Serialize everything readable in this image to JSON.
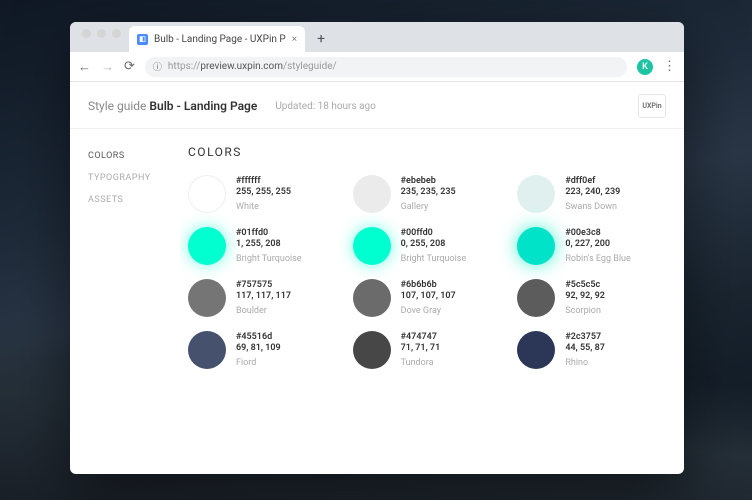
{
  "browser": {
    "tab_title": "Bulb - Landing Page - UXPin P",
    "url_host": "preview.uxpin.com",
    "url_path": "/styleguide/",
    "url_protocol": "https://",
    "avatar_letter": "K",
    "logo_text": "UXPin"
  },
  "header": {
    "prefix": "Style guide ",
    "title": "Bulb - Landing Page",
    "updated": "Updated: 18 hours ago"
  },
  "sidebar": {
    "items": [
      {
        "label": "COLORS",
        "active": true
      },
      {
        "label": "TYPOGRAPHY",
        "active": false
      },
      {
        "label": "ASSETS",
        "active": false
      }
    ]
  },
  "section": {
    "title": "COLORS"
  },
  "swatches": [
    {
      "hex": "#ffffff",
      "rgb": "255, 255, 255",
      "name": "White",
      "color": "#ffffff",
      "cls": "bordered"
    },
    {
      "hex": "#ebebeb",
      "rgb": "235, 235, 235",
      "name": "Gallery",
      "color": "#ebebeb",
      "cls": ""
    },
    {
      "hex": "#dff0ef",
      "rgb": "223, 240, 239",
      "name": "Swans Down",
      "color": "#dff0ef",
      "cls": ""
    },
    {
      "hex": "#01ffd0",
      "rgb": "1, 255, 208",
      "name": "Bright Turquoise",
      "color": "#01ffd0",
      "cls": "glow1"
    },
    {
      "hex": "#00ffd0",
      "rgb": "0, 255, 208",
      "name": "Bright Turquoise",
      "color": "#00ffd0",
      "cls": "glow1"
    },
    {
      "hex": "#00e3c8",
      "rgb": "0, 227, 200",
      "name": "Robin's Egg Blue",
      "color": "#00e3c8",
      "cls": "glow2"
    },
    {
      "hex": "#757575",
      "rgb": "117, 117, 117",
      "name": "Boulder",
      "color": "#757575",
      "cls": ""
    },
    {
      "hex": "#6b6b6b",
      "rgb": "107, 107, 107",
      "name": "Dove Gray",
      "color": "#6b6b6b",
      "cls": ""
    },
    {
      "hex": "#5c5c5c",
      "rgb": "92, 92, 92",
      "name": "Scorpion",
      "color": "#5c5c5c",
      "cls": ""
    },
    {
      "hex": "#45516d",
      "rgb": "69, 81, 109",
      "name": "Fiord",
      "color": "#45516d",
      "cls": ""
    },
    {
      "hex": "#474747",
      "rgb": "71, 71, 71",
      "name": "Tundora",
      "color": "#474747",
      "cls": ""
    },
    {
      "hex": "#2c3757",
      "rgb": "44, 55, 87",
      "name": "Rhino",
      "color": "#2c3757",
      "cls": ""
    }
  ]
}
